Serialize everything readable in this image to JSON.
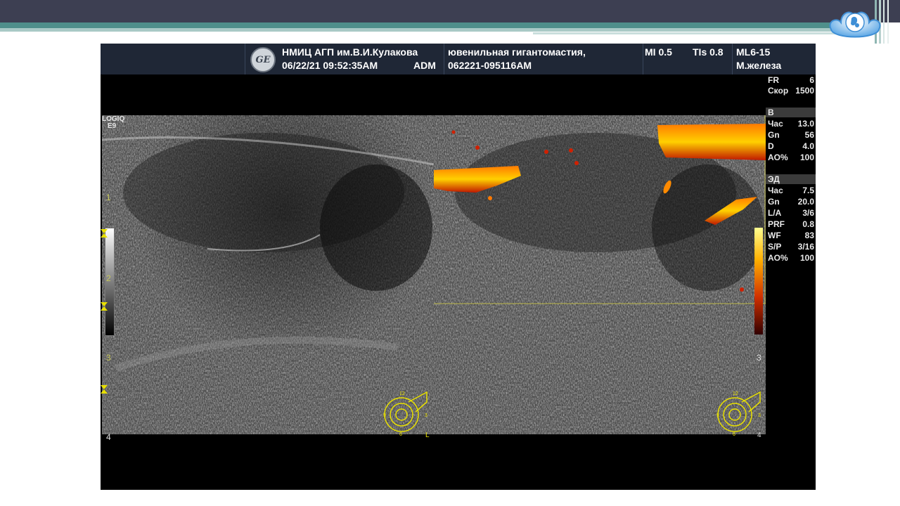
{
  "header": {
    "institution": "НМИЦ АГП им.В.И.Кулакова",
    "datetime": "06/22/21 09:52:35AM",
    "operator": "ADM",
    "study": "ювенильная гигантомастия,",
    "exam_id": "062221-095116AM",
    "mi": "MI 0.5",
    "tis": "TIs 0.8",
    "probe": "ML6-15",
    "preset": "М.железа",
    "ge_logo": "GE"
  },
  "scanner": {
    "model_line1": "LOGIQ",
    "model_line2": "E9"
  },
  "params_top": [
    {
      "label": "FR",
      "value": "6"
    },
    {
      "label": "Скор",
      "value": "1500"
    }
  ],
  "section_b": {
    "title": "В",
    "rows": [
      {
        "label": "Час",
        "value": "13.0"
      },
      {
        "label": "Gn",
        "value": "56"
      },
      {
        "label": "D",
        "value": "4.0"
      },
      {
        "label": "AO%",
        "value": "100"
      }
    ]
  },
  "section_ed": {
    "title": "ЭД",
    "rows": [
      {
        "label": "Час",
        "value": "7.5"
      },
      {
        "label": "Gn",
        "value": "20.0"
      },
      {
        "label": "L/A",
        "value": "3/6"
      },
      {
        "label": "PRF",
        "value": "0.8"
      },
      {
        "label": "WF",
        "value": "83"
      },
      {
        "label": "S/P",
        "value": "3/16"
      },
      {
        "label": "AO%",
        "value": "100"
      }
    ]
  },
  "depth_scale": [
    "1",
    "2",
    "3",
    "4"
  ],
  "body_marker": {
    "ticks": [
      "12",
      "3",
      "6",
      "9"
    ],
    "side_left": "L",
    "side_right": "4"
  },
  "colors": {
    "header_bg": "#1f2736",
    "slide_band": "#3d3f52",
    "slide_accent": "#4f8f8b",
    "doppler_hot": "#ffb000",
    "marker_yellow": "#e8e000"
  },
  "icons": {
    "logo": "mother-child-emblem-icon",
    "body_marker": "breast-clock-diagram-icon"
  }
}
